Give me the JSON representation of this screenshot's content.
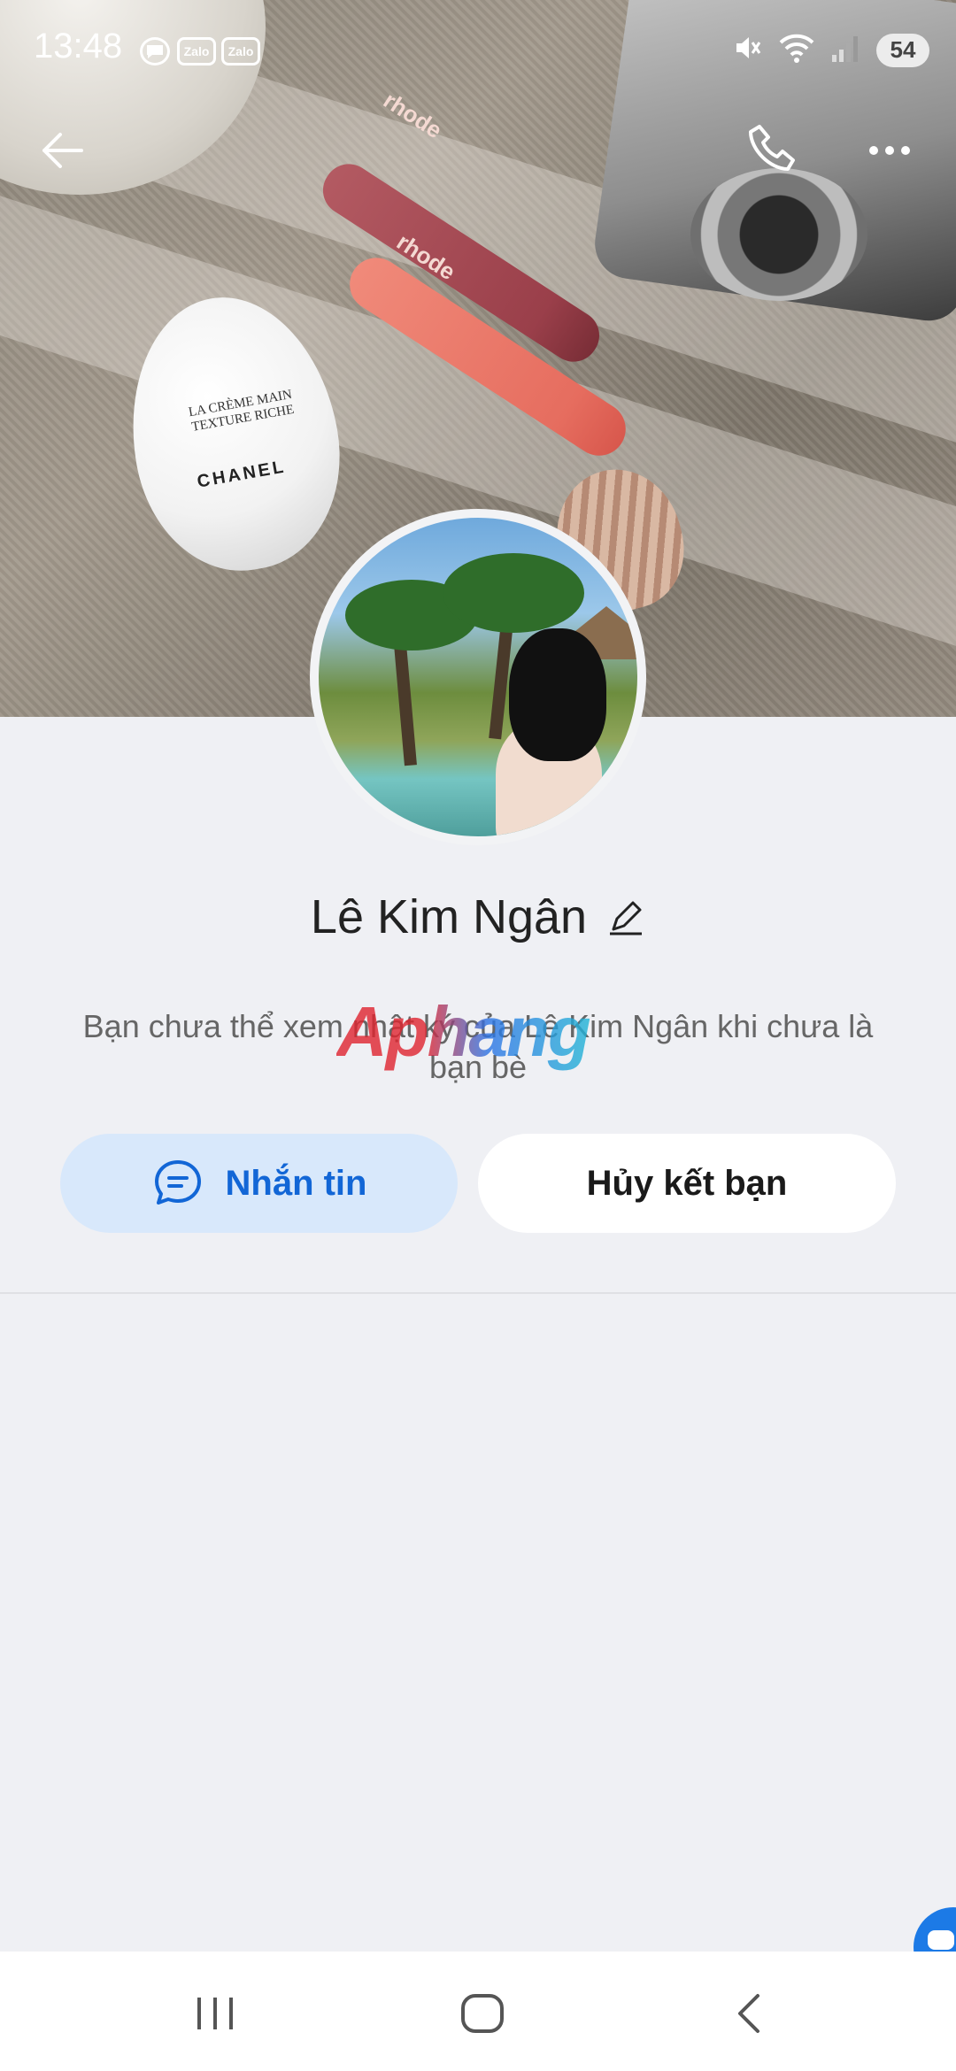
{
  "status_bar": {
    "time": "13:48",
    "notifications": [
      {
        "icon": "chat-bubble-icon"
      },
      {
        "label": "Zalo"
      },
      {
        "label": "Zalo"
      }
    ],
    "icons": [
      "mute-icon",
      "wifi-icon",
      "signal-icon"
    ],
    "battery": "54"
  },
  "header": {
    "back_icon": "arrow-left-icon",
    "call_icon": "phone-icon",
    "more_icon": "more-dots-icon"
  },
  "cover": {
    "tube_label": "rhode",
    "egg_line1": "LA CRÈME MAIN",
    "egg_line2": "TEXTURE RICHE",
    "egg_brand": "CHANEL"
  },
  "profile": {
    "name": "Lê Kim Ngân",
    "info": "Bạn chưa thể xem nhật ký của Lê Kim Ngân khi chưa là bạn bè",
    "watermark": "Aphang"
  },
  "actions": {
    "message_label": "Nhắn tin",
    "unfriend_label": "Hủy kết bạn"
  },
  "colors": {
    "accent": "#1266d6",
    "message_bg": "#d8e8fb",
    "page_bg": "#eff0f4"
  }
}
